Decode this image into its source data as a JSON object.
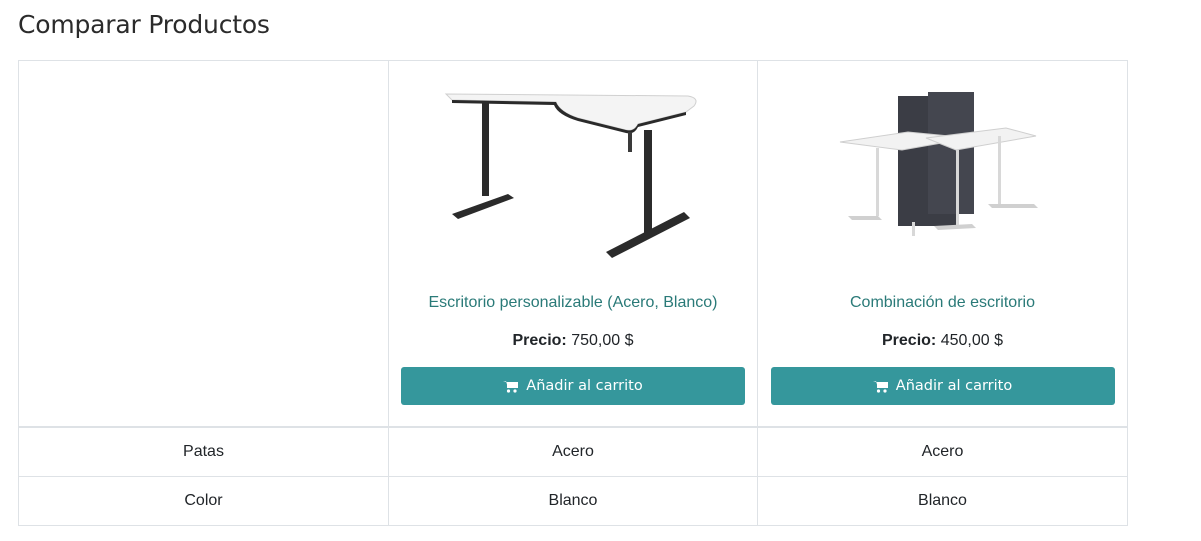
{
  "page": {
    "title": "Comparar Productos"
  },
  "products": [
    {
      "name": "Escritorio personalizable (Acero, Blanco)",
      "price_label": "Precio:",
      "price": "750,00 $",
      "cart_label": "Añadir al carrito",
      "image": "corner-desk"
    },
    {
      "name": "Combinación de escritorio",
      "price_label": "Precio:",
      "price": "450,00 $",
      "cart_label": "Añadir al carrito",
      "image": "desk-combination"
    }
  ],
  "attributes": [
    {
      "name": "Patas",
      "values": [
        "Acero",
        "Acero"
      ]
    },
    {
      "name": "Color",
      "values": [
        "Blanco",
        "Blanco"
      ]
    }
  ],
  "colors": {
    "accent": "#35979c",
    "link": "#2a7a78",
    "border": "#dee2e6"
  },
  "icons": {
    "cart": "shopping-cart-icon"
  }
}
